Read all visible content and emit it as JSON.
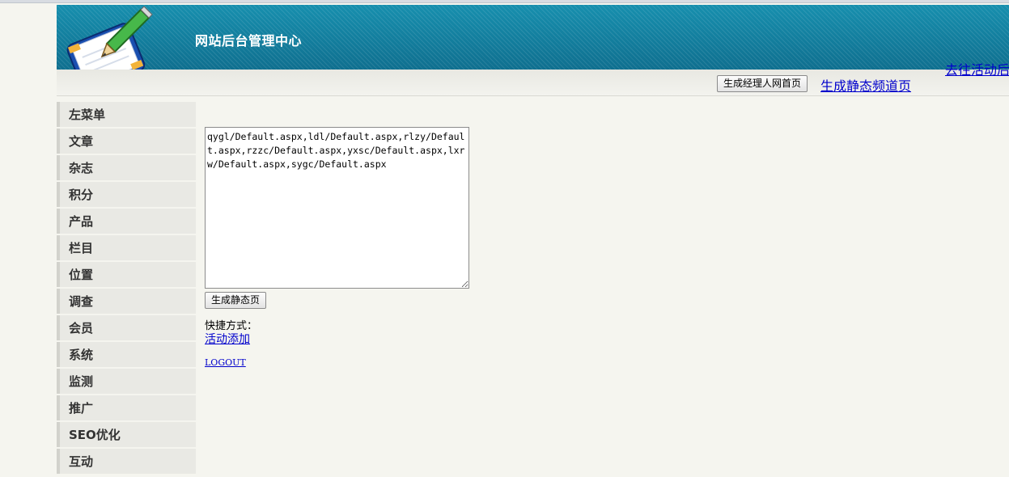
{
  "header": {
    "site_title": "网站后台管理中心"
  },
  "toolbar": {
    "generate_manager_home_button": "生成经理人网首页",
    "generate_static_channel_link": "生成静态频道页",
    "go_to_activity_link": "去往活动后"
  },
  "sidebar": {
    "items": [
      {
        "label": "左菜单"
      },
      {
        "label": "文章"
      },
      {
        "label": "杂志"
      },
      {
        "label": "积分"
      },
      {
        "label": "产品"
      },
      {
        "label": "栏目"
      },
      {
        "label": "位置"
      },
      {
        "label": "调查"
      },
      {
        "label": "会员"
      },
      {
        "label": "系统"
      },
      {
        "label": "监测"
      },
      {
        "label": "推广"
      },
      {
        "label": "SEO优化"
      },
      {
        "label": "互动"
      }
    ]
  },
  "main": {
    "paths_textarea_value": "qygl/Default.aspx,ldl/Default.aspx,rlzy/Default.aspx,rzzc/Default.aspx,yxsc/Default.aspx,lxrw/Default.aspx,sygc/Default.aspx",
    "generate_static_button": "生成静态页",
    "shortcut_label": "快捷方式：",
    "shortcut_add_activity_link": "活动添加",
    "logout_link": "LOGOUT"
  },
  "colors": {
    "header_teal": "#1690b0",
    "link_blue": "#0000cc",
    "page_background": "#f5f5ef"
  },
  "icons": {
    "logo": "pencil-notepad-icon"
  }
}
